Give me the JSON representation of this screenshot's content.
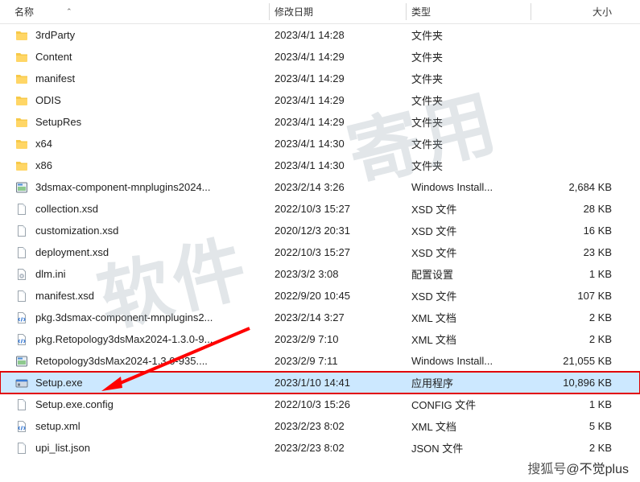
{
  "columns": {
    "name": "名称",
    "date": "修改日期",
    "type": "类型",
    "size": "大小"
  },
  "rows": [
    {
      "icon": "folder",
      "name": "3rdParty",
      "date": "2023/4/1 14:28",
      "type": "文件夹",
      "size": ""
    },
    {
      "icon": "folder",
      "name": "Content",
      "date": "2023/4/1 14:29",
      "type": "文件夹",
      "size": ""
    },
    {
      "icon": "folder",
      "name": "manifest",
      "date": "2023/4/1 14:29",
      "type": "文件夹",
      "size": ""
    },
    {
      "icon": "folder",
      "name": "ODIS",
      "date": "2023/4/1 14:29",
      "type": "文件夹",
      "size": ""
    },
    {
      "icon": "folder",
      "name": "SetupRes",
      "date": "2023/4/1 14:29",
      "type": "文件夹",
      "size": ""
    },
    {
      "icon": "folder",
      "name": "x64",
      "date": "2023/4/1 14:30",
      "type": "文件夹",
      "size": ""
    },
    {
      "icon": "folder",
      "name": "x86",
      "date": "2023/4/1 14:30",
      "type": "文件夹",
      "size": ""
    },
    {
      "icon": "msi",
      "name": "3dsmax-component-mnplugins2024...",
      "date": "2023/2/14 3:26",
      "type": "Windows Install...",
      "size": "2,684 KB"
    },
    {
      "icon": "file",
      "name": "collection.xsd",
      "date": "2022/10/3 15:27",
      "type": "XSD 文件",
      "size": "28 KB"
    },
    {
      "icon": "file",
      "name": "customization.xsd",
      "date": "2020/12/3 20:31",
      "type": "XSD 文件",
      "size": "16 KB"
    },
    {
      "icon": "file",
      "name": "deployment.xsd",
      "date": "2022/10/3 15:27",
      "type": "XSD 文件",
      "size": "23 KB"
    },
    {
      "icon": "ini",
      "name": "dlm.ini",
      "date": "2023/3/2 3:08",
      "type": "配置设置",
      "size": "1 KB"
    },
    {
      "icon": "file",
      "name": "manifest.xsd",
      "date": "2022/9/20 10:45",
      "type": "XSD 文件",
      "size": "107 KB"
    },
    {
      "icon": "xml",
      "name": "pkg.3dsmax-component-mnplugins2...",
      "date": "2023/2/14 3:27",
      "type": "XML 文档",
      "size": "2 KB"
    },
    {
      "icon": "xml",
      "name": "pkg.Retopology3dsMax2024-1.3.0-9...",
      "date": "2023/2/9 7:10",
      "type": "XML 文档",
      "size": "2 KB"
    },
    {
      "icon": "msi",
      "name": "Retopology3dsMax2024-1.3.0-935....",
      "date": "2023/2/9 7:11",
      "type": "Windows Install...",
      "size": "21,055 KB"
    },
    {
      "icon": "exe",
      "name": "Setup.exe",
      "date": "2023/1/10 14:41",
      "type": "应用程序",
      "size": "10,896 KB",
      "selected": true,
      "highlighted": true
    },
    {
      "icon": "file",
      "name": "Setup.exe.config",
      "date": "2022/10/3 15:26",
      "type": "CONFIG 文件",
      "size": "1 KB"
    },
    {
      "icon": "xml",
      "name": "setup.xml",
      "date": "2023/2/23 8:02",
      "type": "XML 文档",
      "size": "5 KB"
    },
    {
      "icon": "file",
      "name": "upi_list.json",
      "date": "2023/2/23 8:02",
      "type": "JSON 文件",
      "size": "2 KB"
    }
  ],
  "watermark": {
    "text1": "软件",
    "text2": "寄用"
  },
  "attribution": {
    "prefix": "搜狐号",
    "name": "@不觉plus"
  }
}
